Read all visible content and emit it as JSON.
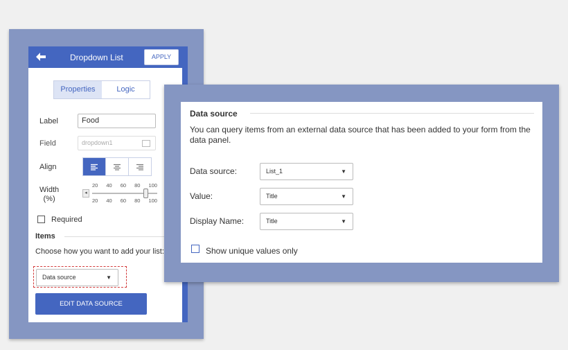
{
  "left_panel": {
    "header": {
      "title": "Dropdown List",
      "apply_label": "APPLY"
    },
    "tabs": [
      {
        "label": "Properties",
        "active": true
      },
      {
        "label": "Logic",
        "active": false
      }
    ],
    "fields": {
      "label": {
        "label": "Label",
        "value": "Food"
      },
      "field": {
        "label": "Field",
        "placeholder": "dropdown1"
      },
      "align": {
        "label": "Align",
        "selected": "left"
      },
      "width": {
        "label": "Width\n(%)",
        "ticks": [
          "20",
          "40",
          "60",
          "80",
          "100"
        ],
        "value_percent": 100
      }
    },
    "required_label": "Required",
    "items": {
      "heading": "Items",
      "prompt": "Choose how you want to add your list:",
      "select_value": "Data source",
      "edit_button_label": "EDIT DATA SOURCE"
    }
  },
  "right_panel": {
    "heading": "Data source",
    "description": "You can query items from an external data source that has been added to your form from the data panel.",
    "rows": [
      {
        "label": "Data source:",
        "value": "List_1"
      },
      {
        "label": "Value:",
        "value": "Title"
      },
      {
        "label": "Display Name:",
        "value": "Title"
      }
    ],
    "checkbox_label": "Show unique values only"
  },
  "colors": {
    "frame": "#8596c2",
    "accent": "#4466c0",
    "highlight_dashed": "#d33a3a"
  }
}
